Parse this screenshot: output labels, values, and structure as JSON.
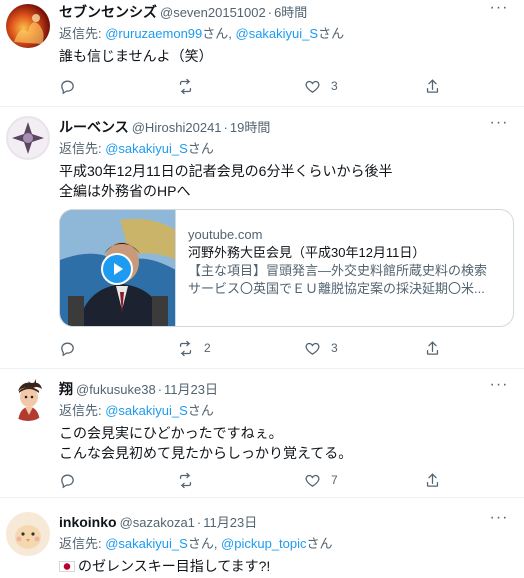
{
  "icons": {
    "more": "more-dots-icon",
    "reply": "reply-icon",
    "retweet": "retweet-icon",
    "like": "heart-icon",
    "share": "share-icon",
    "play": "play-icon"
  },
  "colors": {
    "accent": "#1d9bf0",
    "secondary_text": "#536471",
    "divider": "#eff3f4",
    "card_border": "#cfd9de"
  },
  "tweets": [
    {
      "name": "セブンセンシズ",
      "handle": "@seven20151002",
      "time": "6時間",
      "reply_prefix": "返信先: ",
      "mentions": [
        "@ruruzaemon99",
        "@sakakiyui_S"
      ],
      "mention_sep": "さん, ",
      "reply_suffix": "さん",
      "text": [
        "誰も信じませんよ（笑）"
      ],
      "counts": {
        "reply": "",
        "retweet": "",
        "like": "3"
      }
    },
    {
      "name": "ルーベンス",
      "handle": "@Hiroshi20241",
      "time": "19時間",
      "reply_prefix": "返信先: ",
      "mentions": [
        "@sakakiyui_S"
      ],
      "reply_suffix": "さん",
      "text": [
        "平成30年12月11日の記者会見の6分半くらいから後半",
        "全編は外務省のHPへ"
      ],
      "card": {
        "domain": "youtube.com",
        "title": "河野外務大臣会見（平成30年12月11日）",
        "desc": [
          "【主な項目】冒頭発言―外交史料館所蔵史料の検索",
          "サービス〇英国でＥＵ離脱協定案の採決延期〇米..."
        ]
      },
      "counts": {
        "reply": "",
        "retweet": "2",
        "like": "3"
      }
    },
    {
      "name": "翔",
      "handle": "@fukusuke38",
      "time": "11月23日",
      "reply_prefix": "返信先: ",
      "mentions": [
        "@sakakiyui_S"
      ],
      "reply_suffix": "さん",
      "text": [
        "この会見実にひどかったですねぇ。",
        "こんな会見初めて見たからしっかり覚えてる。"
      ],
      "counts": {
        "reply": "",
        "retweet": "",
        "like": "7"
      }
    },
    {
      "name": "inkoinko",
      "handle": "@sazakoza1",
      "time": "11月23日",
      "reply_prefix": "返信先: ",
      "mentions": [
        "@sakakiyui_S",
        "@pickup_topic"
      ],
      "mention_sep": "さん, ",
      "reply_suffix": "さん",
      "flag_emoji": "🇯🇵",
      "text": [
        "のゼレンスキー目指してます?!"
      ]
    }
  ]
}
